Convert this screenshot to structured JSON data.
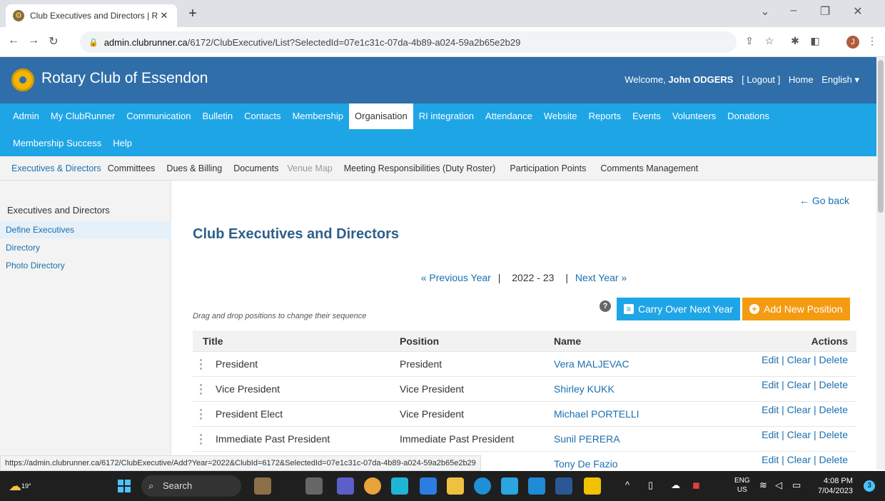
{
  "browser": {
    "tab_title": "Club Executives and Directors | R",
    "tab_close": "✕",
    "new_tab": "+",
    "url_host": "admin.clubrunner.ca",
    "url_path": "/6172/ClubExecutive/List?SelectedId=07e1c31c-07da-4b89-a024-59a2b65e2b29",
    "profile_initial": "J"
  },
  "header": {
    "club_name": "Rotary Club of Essendon",
    "welcome_prefix": "Welcome,",
    "user_name": "John ODGERS",
    "logout": "[ Logout ]",
    "home": "Home",
    "language": "English ▾"
  },
  "main_menu": {
    "row1": [
      "Admin",
      "My ClubRunner",
      "Communication",
      "Bulletin",
      "Contacts",
      "Membership",
      "Organisation",
      "RI integration",
      "Attendance",
      "Website",
      "Reports",
      "Events",
      "Volunteers",
      "Donations"
    ],
    "row2": [
      "Membership Success",
      "Help"
    ],
    "active": "Organisation"
  },
  "sub_menu": {
    "items": [
      "Executives & Directors",
      "Committees",
      "Dues & Billing",
      "Documents",
      "Venue Map",
      "Meeting Responsibilities (Duty Roster)",
      "Participation Points",
      "Comments Management"
    ]
  },
  "sidenav": {
    "heading": "Executives and Directors",
    "links": [
      "Define Executives",
      "Directory",
      "Photo Directory"
    ]
  },
  "content": {
    "go_back": "← Go back",
    "page_title": "Club Executives and Directors",
    "prev_year": "« Previous Year",
    "separator": "|",
    "current_year": "2022 - 23",
    "next_year": "Next Year »",
    "carry_over": "Carry Over Next Year",
    "add_position": "Add New Position",
    "drag_hint": "Drag and drop positions to change their sequence",
    "help": "?"
  },
  "table": {
    "headers": {
      "title": "Title",
      "position": "Position",
      "name": "Name",
      "actions": "Actions"
    },
    "rows": [
      {
        "title": "President",
        "position": "President",
        "name": "Vera MALJEVAC",
        "actions": "Edit | Clear | Delete"
      },
      {
        "title": "Vice President",
        "position": "Vice President",
        "name": "Shirley KUKK",
        "actions": "Edit | Clear | Delete"
      },
      {
        "title": "President Elect",
        "position": "Vice President",
        "name": "Michael PORTELLI",
        "actions": "Edit | Clear | Delete"
      },
      {
        "title": "Immediate Past President",
        "position": "Immediate Past President",
        "name": "Sunil PERERA",
        "actions": "Edit | Clear | Delete"
      },
      {
        "title": "",
        "position": "",
        "name": "Tony De Fazio",
        "actions": "Edit | Clear | Delete"
      }
    ]
  },
  "status_url": "https://admin.clubrunner.ca/6172/ClubExecutive/Add?Year=2022&ClubId=6172&SelectedId=07e1c31c-07da-4b89-a024-59a2b65e2b29",
  "taskbar": {
    "temperature": "19°",
    "search": "Search",
    "lang_top": "ENG",
    "lang_bottom": "US",
    "time": "4:08 PM",
    "date": "7/04/2023",
    "notifications": "3"
  }
}
